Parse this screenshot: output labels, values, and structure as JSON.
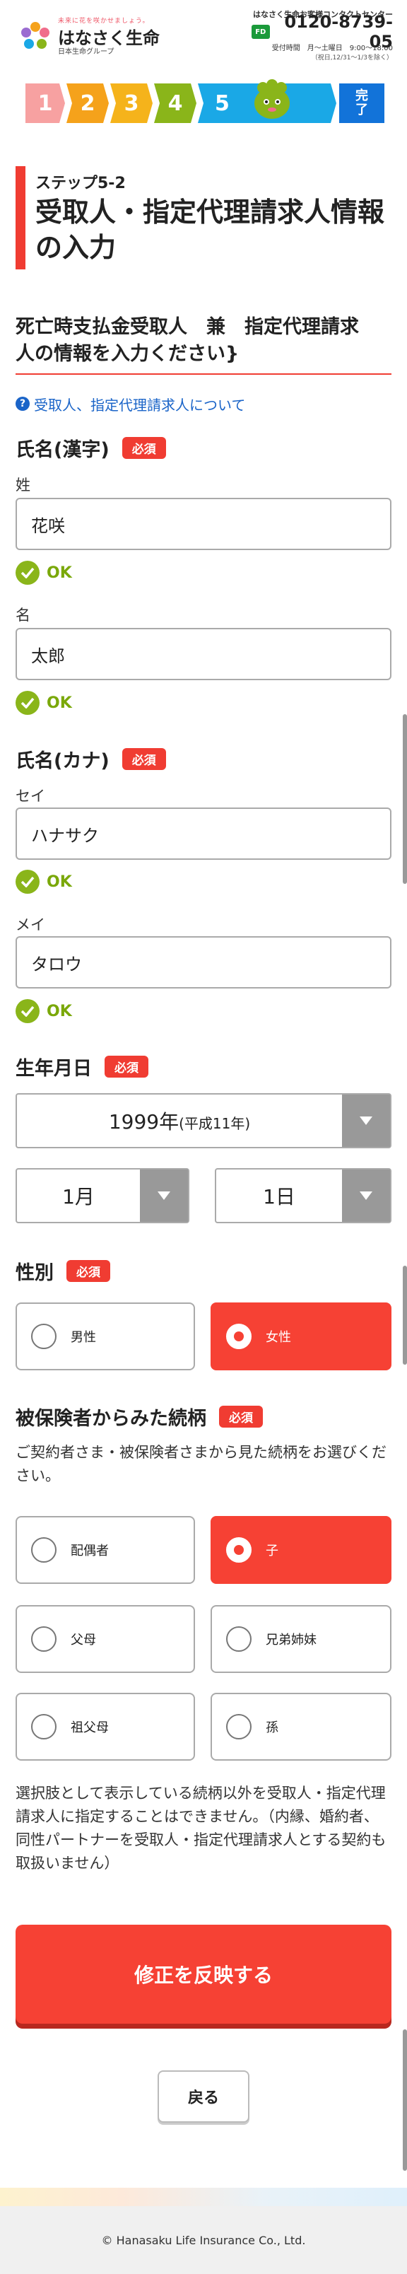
{
  "header": {
    "tagline": "未来に花を咲かせましょう。",
    "brand": "はなさく生命",
    "group": "日本生命グループ",
    "contact_label": "はなさく生命お客様コンタクトセンター",
    "phone_badge": "FD",
    "phone": "0120-8739-05",
    "hours": "受付時間　月〜土曜日　9:00〜18:00",
    "holiday_note": "（祝日,12/31〜1/3を除く）"
  },
  "progress": {
    "steps": [
      "1",
      "2",
      "3",
      "4",
      "5"
    ],
    "colors": [
      "#f7a1a1",
      "#f5a21b",
      "#f5b31b",
      "#8ab51a",
      "#1aa8e6"
    ],
    "complete_label_1": "完",
    "complete_label_2": "了",
    "current_step": 5
  },
  "step": {
    "sub": "ステップ5-2",
    "title_line1": "受取人・指定代理請求人情報",
    "title_line2": "の入力"
  },
  "section": {
    "title_line1": "死亡時支払金受取人　兼　指定代理請求",
    "title_line2": "人の情報を入力ください}"
  },
  "help_link": "受取人、指定代理請求人について",
  "required_label": "必須",
  "ok_label": "OK",
  "name_kanji": {
    "label": "氏名(漢字)",
    "last_label": "姓",
    "last_value": "花咲",
    "first_label": "名",
    "first_value": "太郎"
  },
  "name_kana": {
    "label": "氏名(カナ)",
    "last_label": "セイ",
    "last_value": "ハナサク",
    "first_label": "メイ",
    "first_value": "タロウ"
  },
  "birth": {
    "label": "生年月日",
    "year": "1999年",
    "era": "(平成11年)",
    "month": "1月",
    "day": "1日"
  },
  "gender": {
    "label": "性別",
    "options": [
      "男性",
      "女性"
    ],
    "selected": "女性"
  },
  "relation": {
    "label": "被保険者からみた続柄",
    "description": "ご契約者さま・被保険者さまから見た続柄をお選びください。",
    "options": [
      "配偶者",
      "子",
      "父母",
      "兄弟姉妹",
      "祖父母",
      "孫"
    ],
    "selected": "子",
    "note": "選択肢として表示している続柄以外を受取人・指定代理請求人に指定することはできません。（内縁、婚約者、同性パートナーを受取人・指定代理請求人とする契約も取扱いません）"
  },
  "buttons": {
    "submit": "修正を反映する",
    "back": "戻る"
  },
  "footer": {
    "copyright": "© Hanasaku Life Insurance Co., Ltd."
  }
}
